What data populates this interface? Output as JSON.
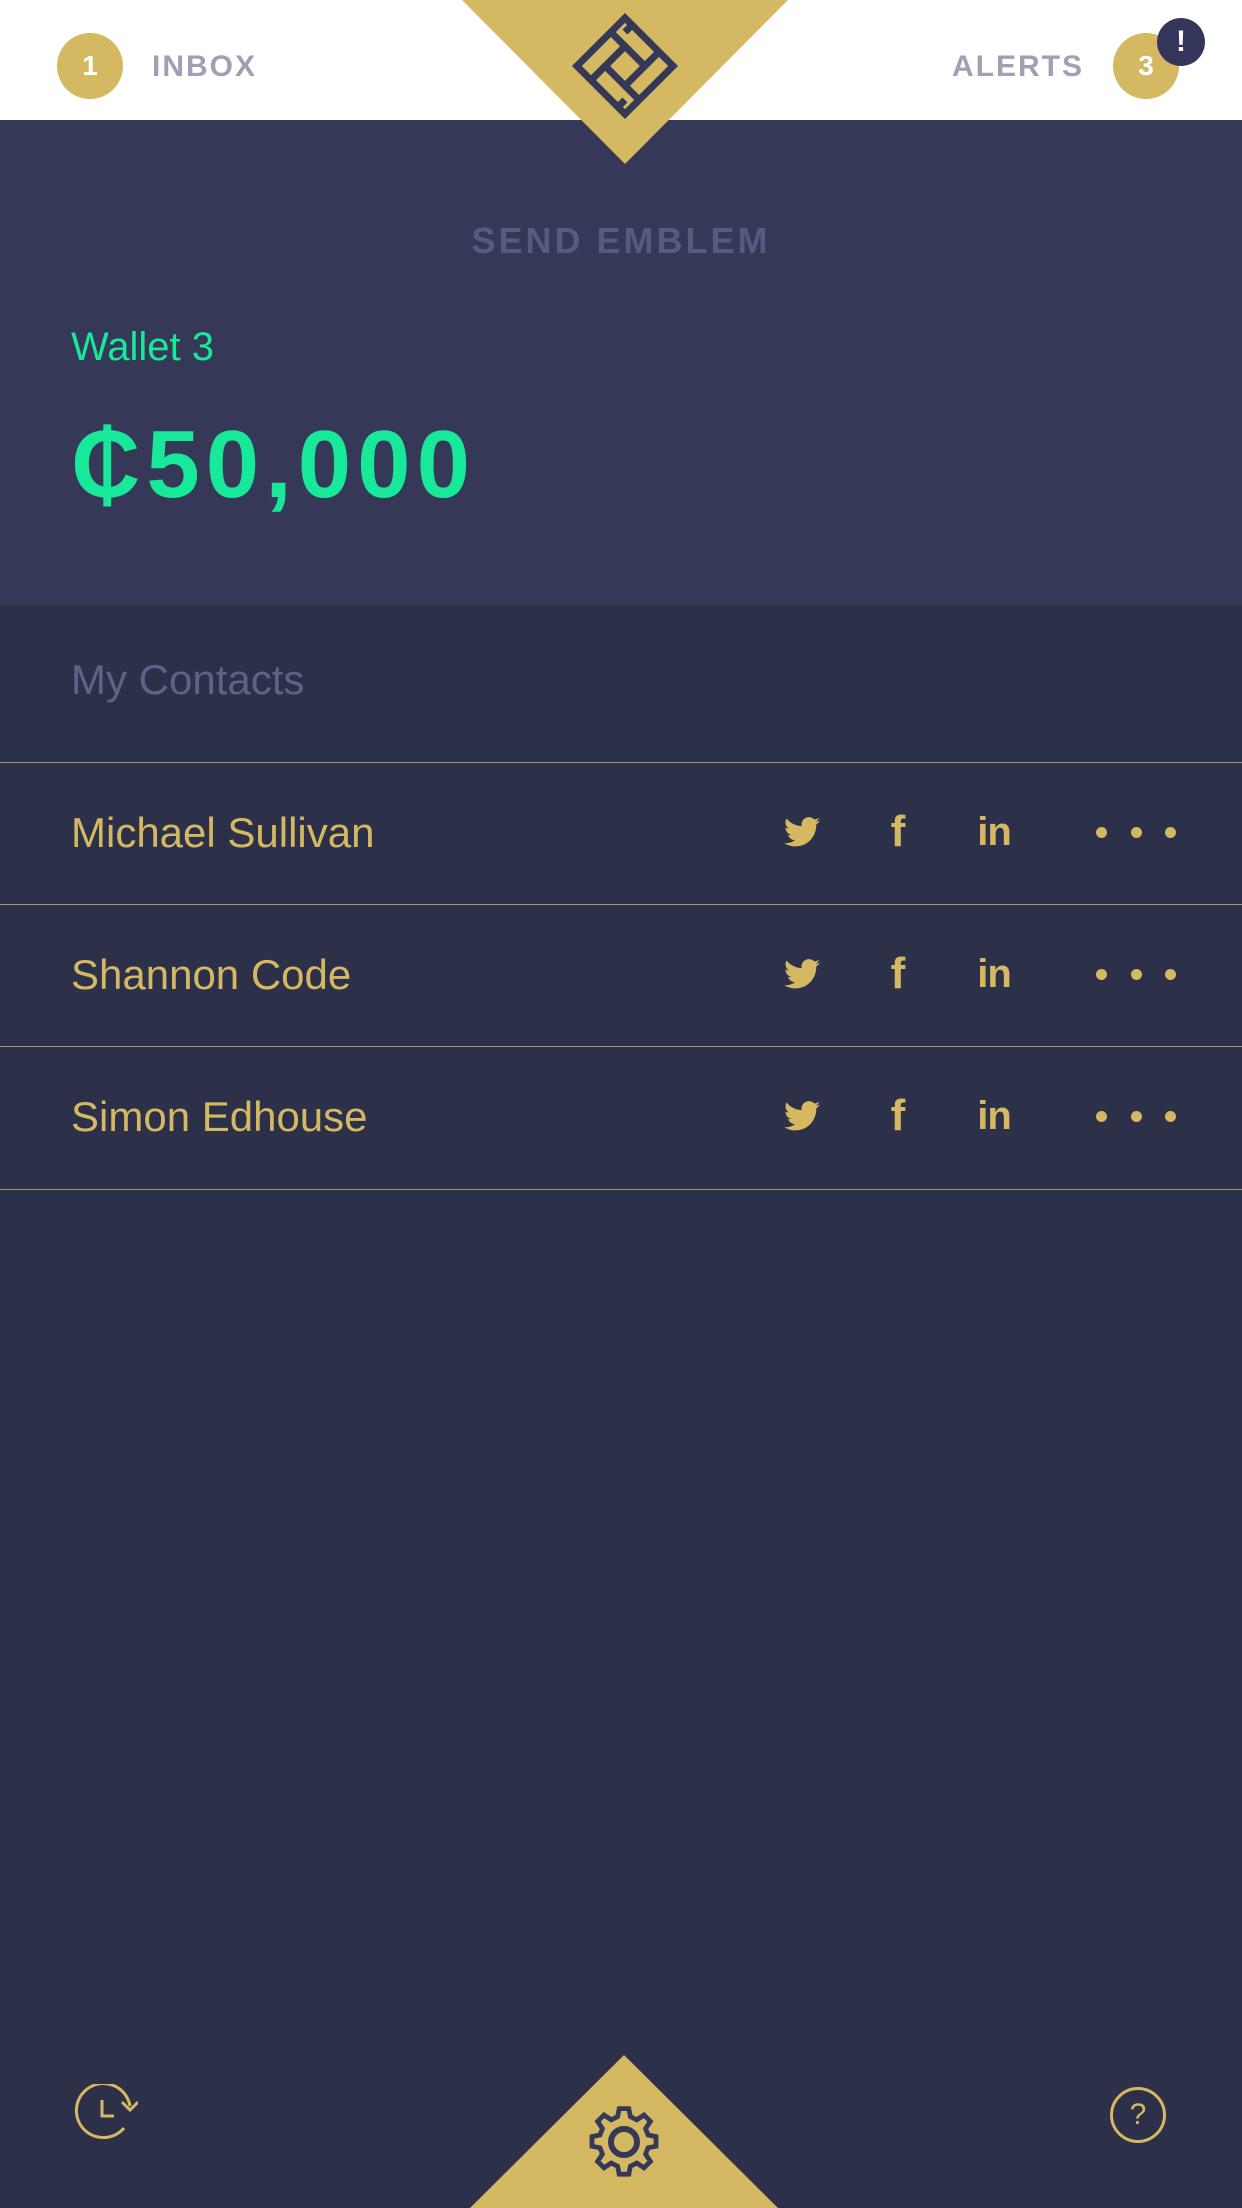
{
  "header": {
    "inbox_count": "1",
    "inbox_label": "INBOX",
    "alerts_label": "ALERTS",
    "alerts_count": "3",
    "alert_badge": "!",
    "logo_icon": "emblem-logo-icon"
  },
  "wallet": {
    "title": "SEND EMBLEM",
    "name": "Wallet 3",
    "amount": "₵50,000"
  },
  "contacts": {
    "heading": "My Contacts",
    "items": [
      {
        "name": "Michael Sullivan"
      },
      {
        "name": "Shannon Code"
      },
      {
        "name": "Simon Edhouse"
      }
    ],
    "social_glyphs": {
      "facebook": "f",
      "linkedin": "in"
    }
  },
  "footer": {
    "history_icon": "history-icon",
    "settings_icon": "gear-icon",
    "help_label": "?"
  },
  "colors": {
    "accent_gold": "#d4b862",
    "wallet_green": "#17e89a",
    "background": "#2d3049",
    "wallet_panel": "#363857"
  }
}
